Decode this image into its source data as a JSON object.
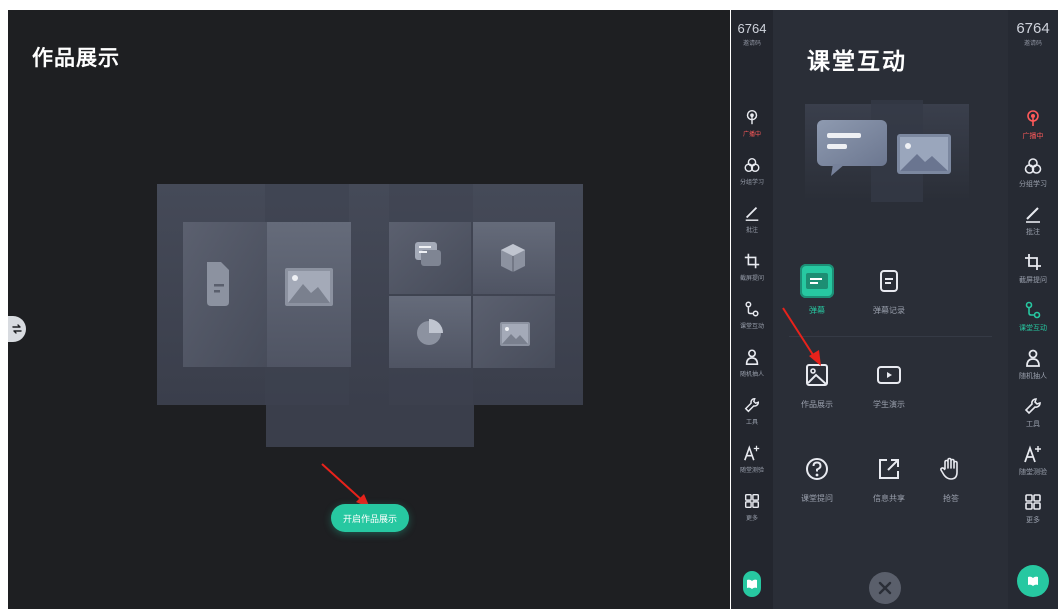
{
  "stage": {
    "title": "作品展示",
    "start_button": "开启作品展示"
  },
  "toolbar_mid": {
    "code": "6764",
    "code_label": "邀请码",
    "items": [
      {
        "label": "广播中",
        "icon": "broadcast-icon",
        "state": "live"
      },
      {
        "label": "分组学习",
        "icon": "group-learning-icon"
      },
      {
        "label": "批注",
        "icon": "annotate-pen-icon"
      },
      {
        "label": "截屏提问",
        "icon": "crop-icon"
      },
      {
        "label": "课堂互动",
        "icon": "interaction-icon"
      },
      {
        "label": "随机抽人",
        "icon": "random-pick-icon"
      },
      {
        "label": "工具",
        "icon": "wrench-icon"
      },
      {
        "label": "随堂测验",
        "icon": "quiz-icon"
      },
      {
        "label": "更多",
        "icon": "more-grid-icon"
      }
    ]
  },
  "toolbar_right": {
    "code": "6764",
    "code_label": "邀请码",
    "items": [
      {
        "label": "广播中",
        "icon": "broadcast-icon",
        "state": "live"
      },
      {
        "label": "分组学习",
        "icon": "group-learning-icon"
      },
      {
        "label": "批注",
        "icon": "annotate-pen-icon"
      },
      {
        "label": "截屏提问",
        "icon": "crop-icon"
      },
      {
        "label": "课堂互动",
        "icon": "interaction-icon",
        "state": "active"
      },
      {
        "label": "随机抽人",
        "icon": "random-pick-icon"
      },
      {
        "label": "工具",
        "icon": "wrench-icon"
      },
      {
        "label": "随堂测验",
        "icon": "quiz-icon"
      },
      {
        "label": "更多",
        "icon": "more-grid-icon"
      }
    ]
  },
  "panel": {
    "title": "课堂互动",
    "tools": [
      {
        "label": "弹幕",
        "icon": "danmaku-icon",
        "state": "active"
      },
      {
        "label": "弹幕记录",
        "icon": "danmaku-record-icon"
      },
      {
        "label": "作品展示",
        "icon": "works-display-icon"
      },
      {
        "label": "学生演示",
        "icon": "student-demo-icon"
      },
      {
        "label": "课堂提问",
        "icon": "question-icon"
      },
      {
        "label": "信息共享",
        "icon": "share-icon"
      },
      {
        "label": "抢答",
        "icon": "raise-hand-icon"
      }
    ]
  },
  "colors": {
    "accent": "#27c8a1",
    "live": "#ff5a5a",
    "stage_bg": "#1e1f22",
    "panel_bg": "#2a2e37"
  }
}
